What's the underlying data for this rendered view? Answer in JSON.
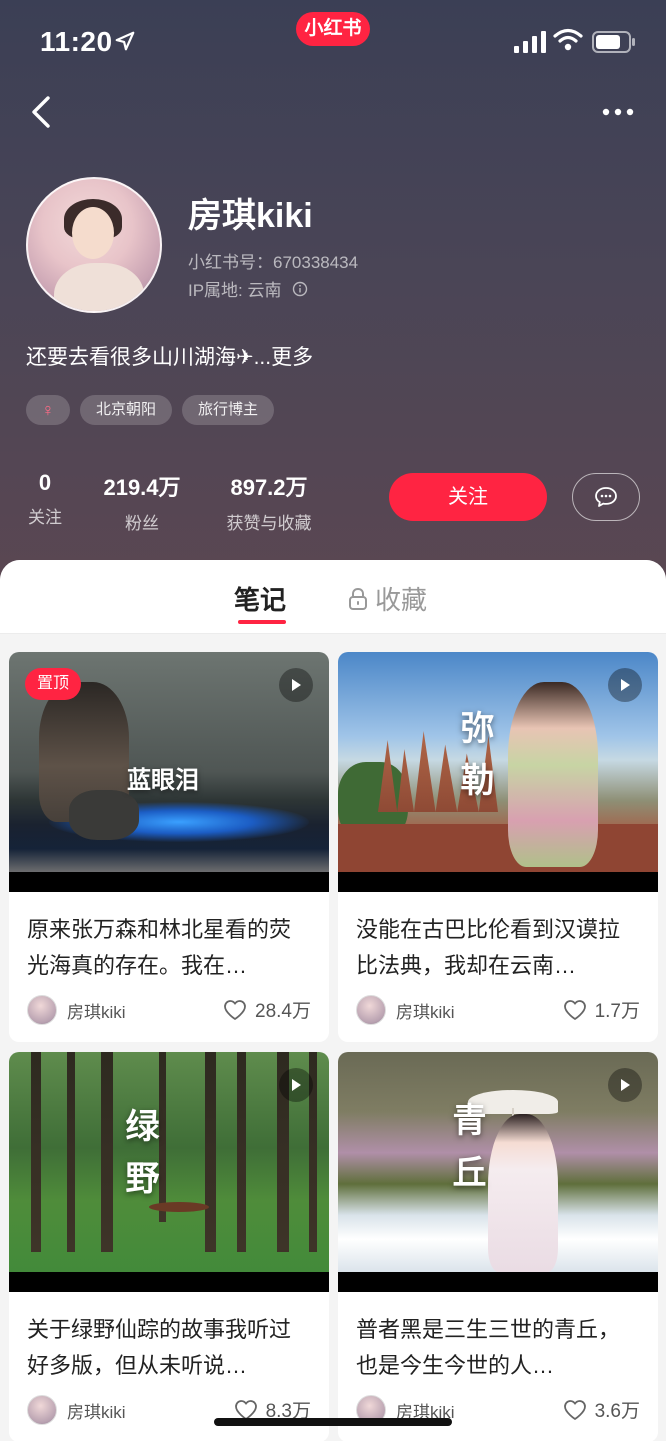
{
  "status_bar": {
    "time": "11:20",
    "app_badge": "小红书"
  },
  "profile": {
    "nickname": "房琪kiki",
    "red_id": "小红书号：670338434",
    "ip_location": "IP属地: 云南",
    "bio": "还要去看很多山川湖海✈...更多",
    "tags": [
      "♀",
      "北京朝阳",
      "旅行博主"
    ],
    "stats": [
      {
        "value": "0",
        "label": "关注"
      },
      {
        "value": "219.4万",
        "label": "粉丝"
      },
      {
        "value": "897.2万",
        "label": "获赞与收藏"
      }
    ],
    "follow_label": "关注"
  },
  "tabs": {
    "notes": "笔记",
    "collect": "收藏"
  },
  "notes": [
    {
      "pin": "置顶",
      "thumb_text": "蓝眼泪",
      "title": "原来张万森和林北星看的荧光海真的存在。我在…",
      "author": "房琪kiki",
      "likes": "28.4万"
    },
    {
      "thumb_text": "弥勒",
      "title": "没能在古巴比伦看到汉谟拉比法典，我却在云南…",
      "author": "房琪kiki",
      "likes": "1.7万"
    },
    {
      "thumb_text": "绿野",
      "title": "关于绿野仙踪的故事我听过好多版，但从未听说…",
      "author": "房琪kiki",
      "likes": "8.3万"
    },
    {
      "thumb_text": "青丘",
      "title": "普者黑是三生三世的青丘，也是今生今世的人…",
      "author": "房琪kiki",
      "likes": "3.6万"
    }
  ],
  "colors": {
    "accent": "#ff2442",
    "header_top": "#3b3f55",
    "header_bottom": "#5b4752"
  }
}
